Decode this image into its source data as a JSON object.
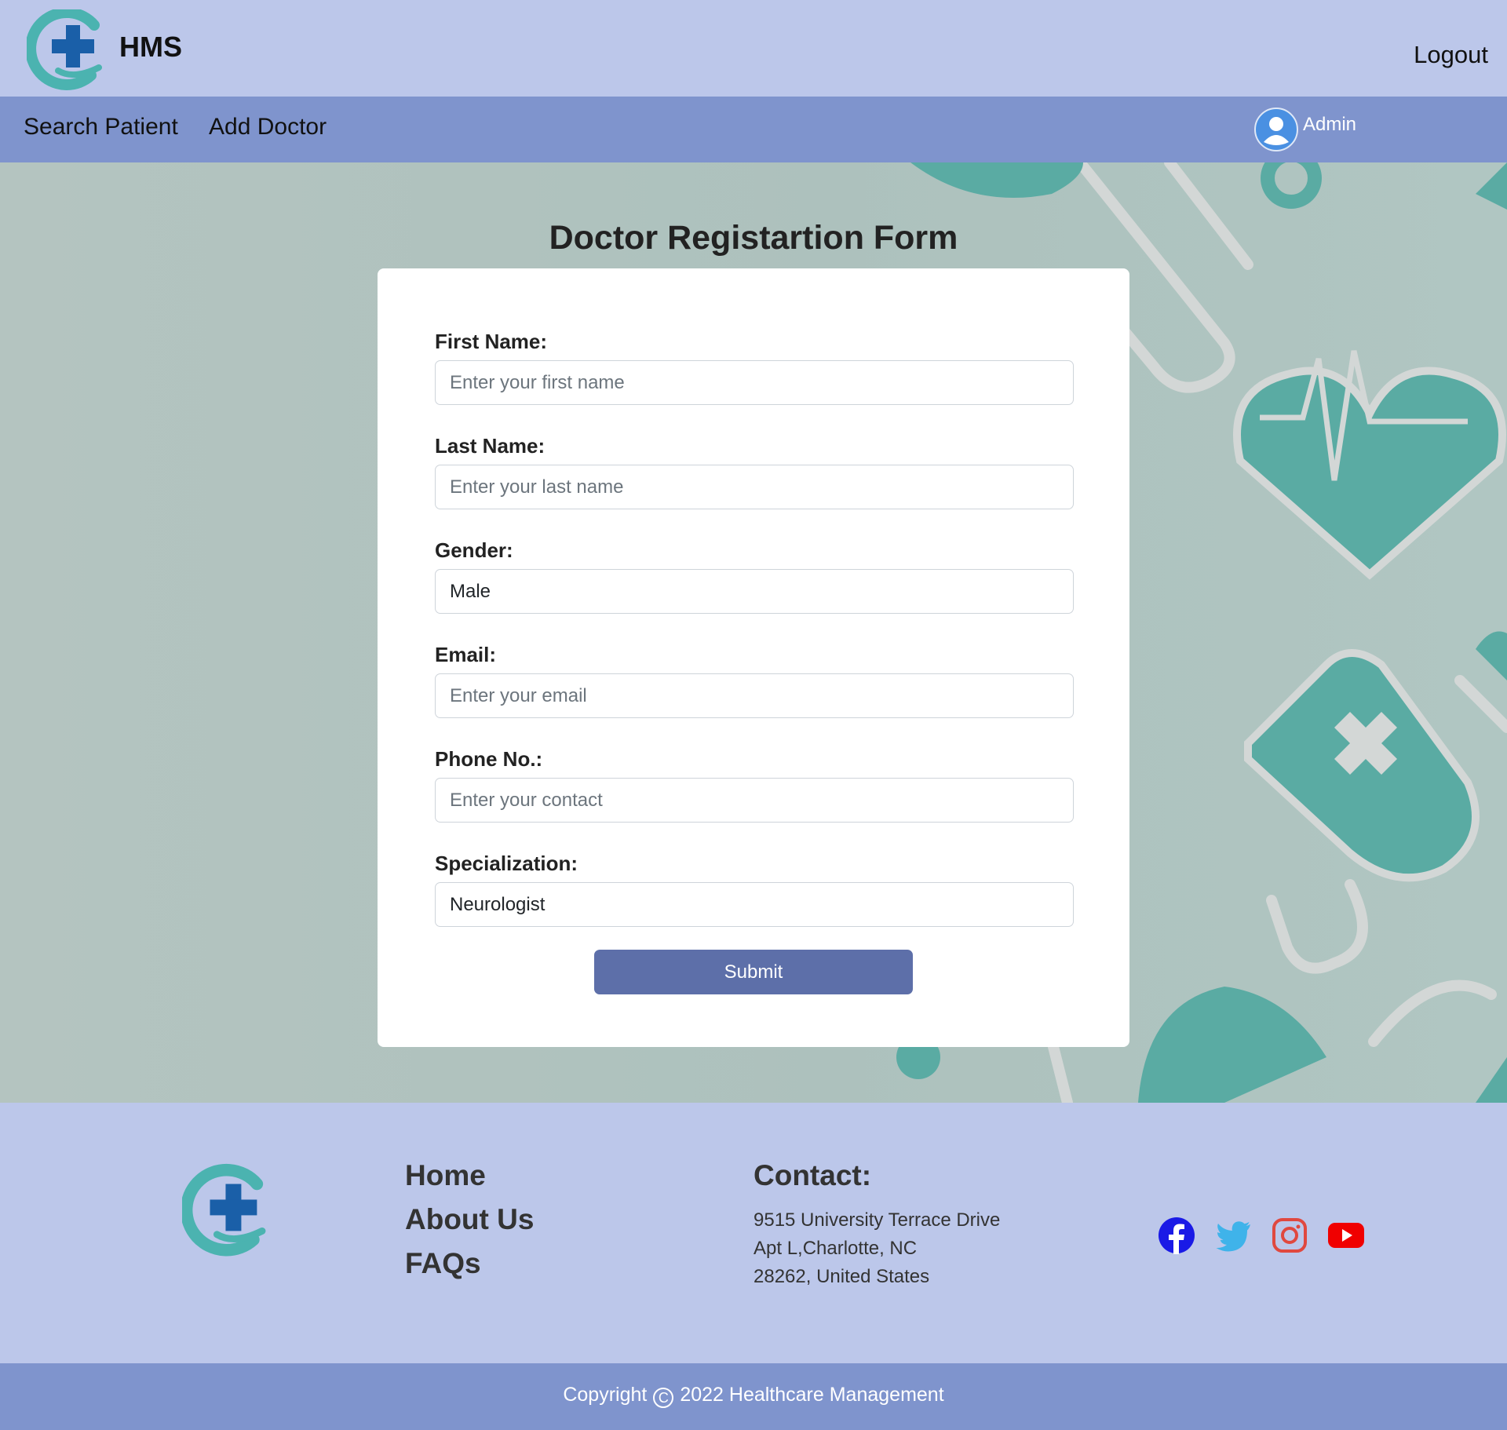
{
  "header": {
    "brand": "HMS",
    "logout_label": "Logout"
  },
  "nav": {
    "items": [
      {
        "label": "Search Patient"
      },
      {
        "label": "Add Doctor"
      }
    ],
    "user": "Admin"
  },
  "form": {
    "title": "Doctor Registartion Form",
    "fields": [
      {
        "label": "First Name:",
        "placeholder": "Enter your first name",
        "value": ""
      },
      {
        "label": "Last Name:",
        "placeholder": "Enter your last name",
        "value": ""
      },
      {
        "label": "Gender:",
        "placeholder": "",
        "value": "Male"
      },
      {
        "label": "Email:",
        "placeholder": "Enter your email",
        "value": ""
      },
      {
        "label": "Phone No.:",
        "placeholder": "Enter your contact",
        "value": ""
      },
      {
        "label": "Specialization:",
        "placeholder": "",
        "value": "Neurologist"
      }
    ],
    "submit_label": "Submit"
  },
  "footer": {
    "links": [
      "Home",
      "About Us",
      "FAQs"
    ],
    "contact_title": "Contact:",
    "address": [
      "9515 University Terrace Drive",
      "Apt L,Charlotte, NC",
      "28262, United States"
    ],
    "socials": [
      "facebook-icon",
      "twitter-icon",
      "instagram-icon",
      "youtube-icon"
    ],
    "copyright_prefix": "Copyright",
    "copyright_text": "2022 Healthcare Management"
  },
  "colors": {
    "header_bg": "#bcc7ea",
    "nav_bg": "#7f94cd",
    "button": "#5d6fa9",
    "teal": "#5aaba3",
    "logo_blue": "#1a5fa8"
  }
}
